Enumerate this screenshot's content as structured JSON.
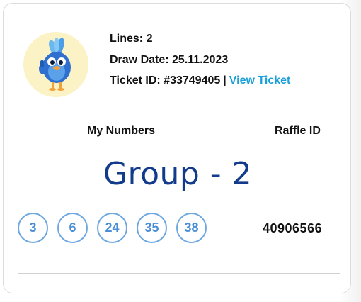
{
  "ticket": {
    "lines_label": "Lines:",
    "lines_value": "2",
    "draw_date_label": "Draw Date:",
    "draw_date_value": "25.11.2023",
    "ticket_id_label": "Ticket ID:",
    "ticket_id_value": "#33749405",
    "separator": "|",
    "view_ticket_link": "View Ticket"
  },
  "columns": {
    "numbers_header": "My Numbers",
    "raffle_header": "Raffle ID"
  },
  "group_label": "Group - 2",
  "numbers": [
    "3",
    "6",
    "24",
    "35",
    "38"
  ],
  "raffle_id": "40906566",
  "colors": {
    "link": "#1ca0d8",
    "ball_border": "#6fa8e0",
    "ball_text": "#4a8fd6",
    "group_label": "#123b8c",
    "avatar_bg": "#fbf3c5"
  },
  "icons": {
    "avatar": "blue-bird-mascot-icon"
  }
}
